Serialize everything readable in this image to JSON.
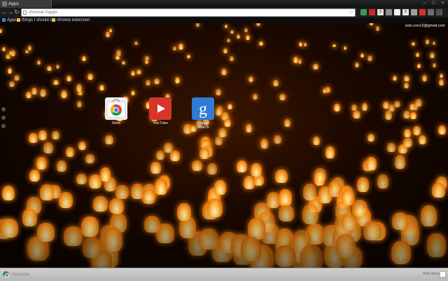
{
  "window": {
    "tab_title": "Apps",
    "controls": [
      "–",
      "□",
      "×"
    ]
  },
  "toolbar": {
    "back": "←",
    "forward": "→",
    "reload": "↻",
    "url": "chrome://apps",
    "star": "☆",
    "extensions": [
      {
        "icon": "green-square-icon",
        "color": "#3c9a4b",
        "glyph": ""
      },
      {
        "icon": "red-badge-icon",
        "color": "#c62828",
        "glyph": ""
      },
      {
        "icon": "bar-icon",
        "color": "#e0e0e0",
        "glyph": "≡"
      },
      {
        "icon": "puzzle-icon",
        "color": "#8d8d8d",
        "glyph": ""
      },
      {
        "icon": "white-square-icon",
        "color": "#f1f1f1",
        "glyph": ""
      },
      {
        "icon": "b-icon",
        "color": "#e8e8e8",
        "glyph": "b"
      },
      {
        "icon": "gray-square-icon",
        "color": "#9e9e9e",
        "glyph": ""
      },
      {
        "icon": "red-square-icon",
        "color": "#d32f2f",
        "glyph": ""
      },
      {
        "icon": "clock-icon",
        "color": "#6d6d6d",
        "glyph": ""
      },
      {
        "icon": "menu-icon",
        "color": "#555555",
        "glyph": "≡"
      }
    ]
  },
  "bookmarks": {
    "apps": "Apps",
    "item1": "things I should l...",
    "item2": "chrome extension"
  },
  "content": {
    "user_email": "solo.con13@gmail.com",
    "apps": [
      {
        "name": "Store",
        "icon": "chrome-web-store-icon"
      },
      {
        "name": "YouTube",
        "icon": "youtube-icon"
      },
      {
        "name": "Google Search",
        "icon": "google-search-icon"
      }
    ]
  },
  "footer": {
    "word": "chrome",
    "store": "Web Store"
  },
  "colors": {
    "accent_orange": "#ff9a1f",
    "youtube_red": "#d7352a",
    "google_blue": "#2f7bd6"
  }
}
